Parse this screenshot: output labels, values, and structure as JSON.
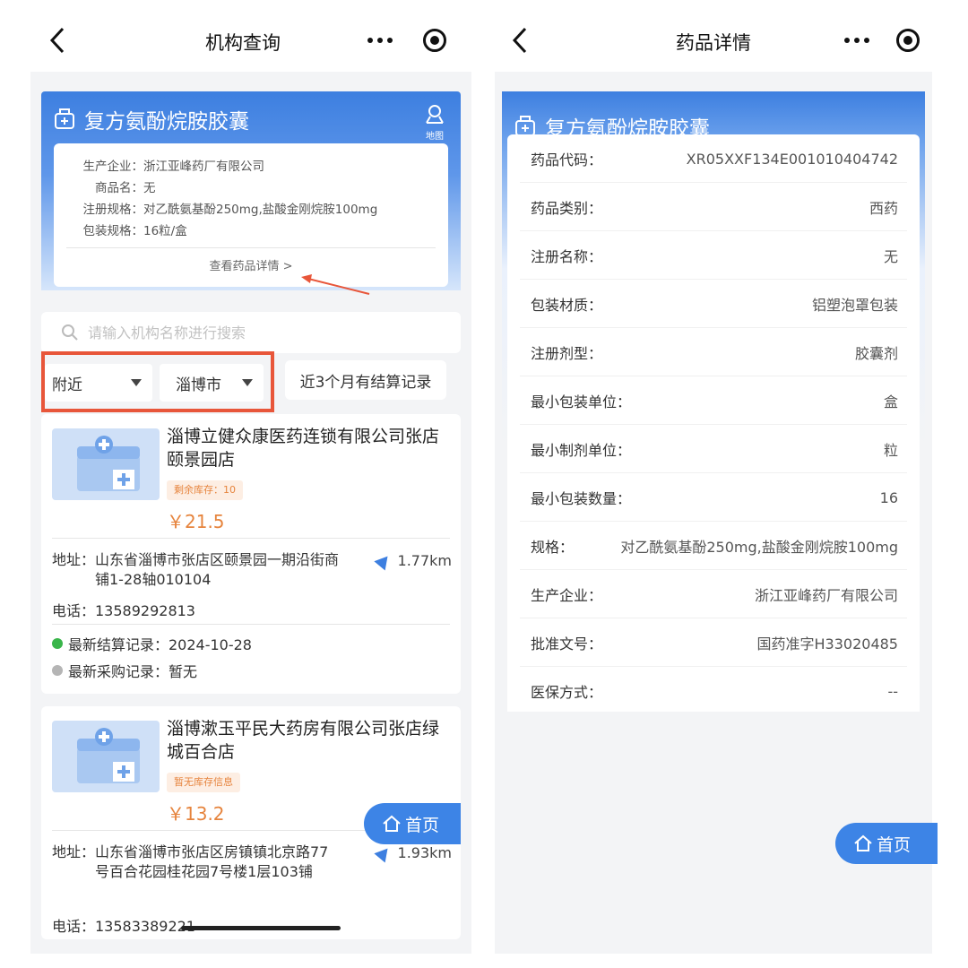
{
  "left": {
    "nav_title": "机构查询",
    "drug_name": "复方氨酚烷胺胶囊",
    "map_label": "地图",
    "info": [
      {
        "label": "生产企业：",
        "value": "浙江亚峰药厂有限公司"
      },
      {
        "label": "商品名：",
        "value": "无"
      },
      {
        "label": "注册规格：",
        "value": "对乙酰氨基酚250mg,盐酸金刚烷胺100mg"
      },
      {
        "label": "包装规格：",
        "value": "16粒/盒"
      }
    ],
    "view_detail": "查看药品详情 >",
    "search_placeholder": "请输入机构名称进行搜索",
    "filter_nearby": "附近",
    "filter_city": "淄博市",
    "filter_settle": "近3个月有结算记录",
    "stores": [
      {
        "name": "淄博立健众康医药连锁有限公司张店颐景园店",
        "stock": "剩余库存：10",
        "price": "￥21.5",
        "address_label": "地址：",
        "address": "山东省淄博市张店区颐景园一期沿街商铺1-28轴010104",
        "distance": "1.77km",
        "phone": "电话：13589292813",
        "settle": "最新结算记录：2024-10-28",
        "purchase": "最新采购记录：暂无"
      },
      {
        "name": "淄博漱玉平民大药房有限公司张店绿城百合店",
        "stock": "暂无库存信息",
        "price": "￥13.2",
        "address_label": "地址：",
        "address": "山东省淄博市张店区房镇镇北京路77号百合花园桂花园7号楼1层103铺",
        "distance": "1.93km",
        "phone": "电话：13583389221"
      }
    ],
    "home_label": "首页"
  },
  "right": {
    "nav_title": "药品详情",
    "drug_name": "复方氨酚烷胺胶囊",
    "rows": [
      {
        "k": "药品代码：",
        "v": "XR05XXF134E001010404742"
      },
      {
        "k": "药品类别：",
        "v": "西药"
      },
      {
        "k": "注册名称：",
        "v": "无"
      },
      {
        "k": "包装材质：",
        "v": "铝塑泡罩包装"
      },
      {
        "k": "注册剂型：",
        "v": "胶囊剂"
      },
      {
        "k": "最小包装单位：",
        "v": "盒"
      },
      {
        "k": "最小制剂单位：",
        "v": "粒"
      },
      {
        "k": "最小包装数量：",
        "v": "16"
      },
      {
        "k": "规格：",
        "v": "对乙酰氨基酚250mg,盐酸金刚烷胺100mg"
      },
      {
        "k": "生产企业：",
        "v": "浙江亚峰药厂有限公司"
      },
      {
        "k": "批准文号：",
        "v": "国药准字H33020485"
      },
      {
        "k": "医保方式：",
        "v": "--"
      }
    ],
    "home_label": "首页"
  },
  "colors": {
    "accent": "#3d84e6",
    "highlight": "#e8563a",
    "price": "#e6843d"
  }
}
